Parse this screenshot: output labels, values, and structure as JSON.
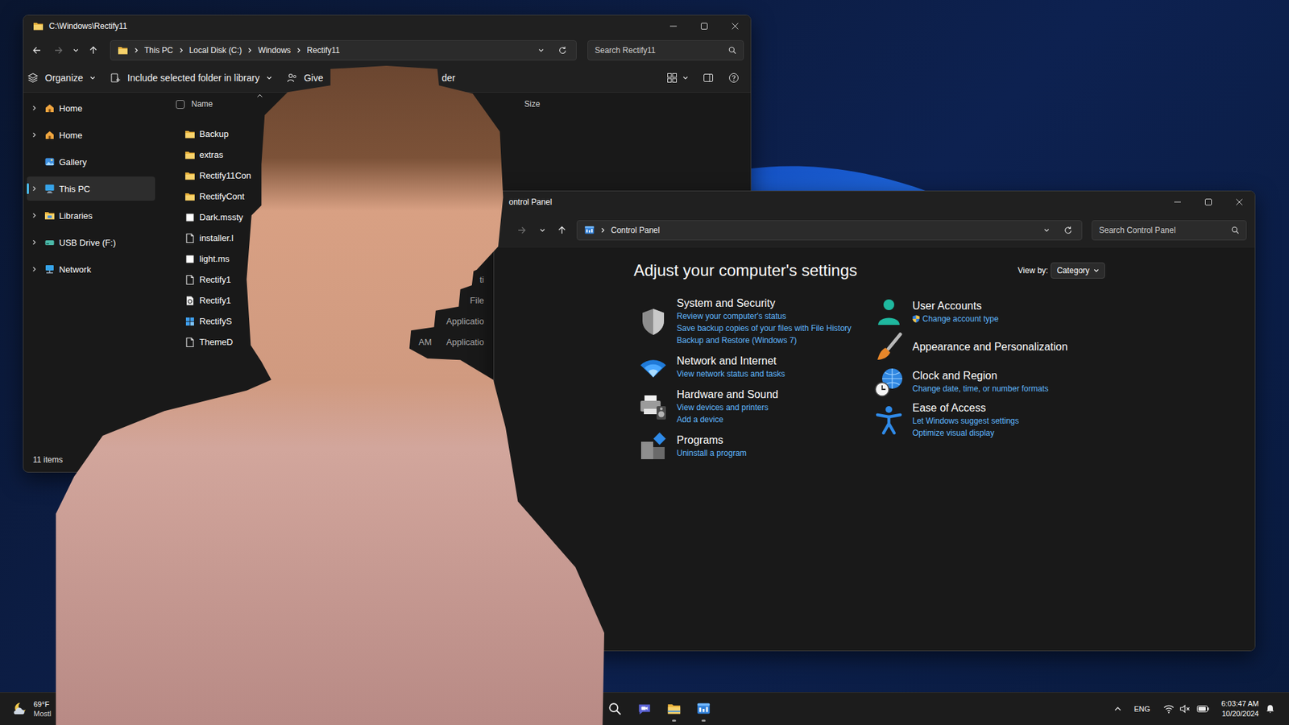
{
  "explorer": {
    "title": "C:\\Windows\\Rectify11",
    "nav": {
      "back_enabled": true,
      "forward_enabled": false
    },
    "breadcrumb": [
      "This PC",
      "Local Disk (C:)",
      "Windows",
      "Rectify11"
    ],
    "search": {
      "placeholder": "Search Rectify11"
    },
    "toolbar": [
      {
        "label": "Organize",
        "dropdown": true
      },
      {
        "label": "Include selected folder in library",
        "dropdown": true
      },
      {
        "label": "Give",
        "dropdown": false
      }
    ],
    "toolbar_fragment": "der",
    "sidebar": [
      {
        "label": "Home",
        "expandable": true,
        "selected": false
      },
      {
        "label": "Home",
        "expandable": true,
        "selected": false
      },
      {
        "label": "Gallery",
        "expandable": false,
        "selected": false
      },
      {
        "label": "This PC",
        "expandable": true,
        "selected": true
      },
      {
        "label": "Libraries",
        "expandable": true,
        "selected": false
      },
      {
        "label": "USB Drive (F:)",
        "expandable": true,
        "selected": false
      },
      {
        "label": "Network",
        "expandable": true,
        "selected": false
      }
    ],
    "columns": {
      "select_all_checked": false,
      "sorted": true,
      "name": "Name",
      "size": "Size"
    },
    "rows": [
      {
        "name": "Backup",
        "kind": "folder"
      },
      {
        "name": "extras",
        "kind": "folder"
      },
      {
        "name": "Rectify11Con",
        "kind": "folder"
      },
      {
        "name": "RectifyCont",
        "kind": "folder"
      },
      {
        "name": "Dark.mssty",
        "kind": "style"
      },
      {
        "name": "installer.l",
        "kind": "file"
      },
      {
        "name": "light.ms",
        "kind": "style"
      },
      {
        "name": "Rectify1",
        "kind": "file",
        "type": "ti"
      },
      {
        "name": "Rectify1",
        "kind": "tool",
        "type": "File"
      },
      {
        "name": "RectifyS",
        "kind": "app",
        "type": "Applicatio"
      },
      {
        "name": "ThemeD",
        "kind": "file",
        "date": "AM",
        "type": "Applicatio"
      }
    ],
    "status": "11 items"
  },
  "control_panel": {
    "title": "ontrol Panel",
    "nav": {
      "forward_enabled": false
    },
    "breadcrumb": [
      "Control Panel"
    ],
    "search": {
      "placeholder": "Search Control Panel"
    },
    "heading": "Adjust your computer's settings",
    "view_by": {
      "label": "View by:",
      "value": "Category"
    },
    "category_columns": [
      [
        {
          "title": "System and Security",
          "links": [
            {
              "label": "Review your computer's status",
              "shield": false
            },
            {
              "label": "Save backup copies of your files with File History",
              "shield": false
            },
            {
              "label": "Backup and Restore (Windows 7)",
              "shield": false
            }
          ]
        },
        {
          "title": "Network and Internet",
          "links": [
            {
              "label": "View network status and tasks",
              "shield": false
            }
          ]
        },
        {
          "title": "Hardware and Sound",
          "links": [
            {
              "label": "View devices and printers",
              "shield": false
            },
            {
              "label": "Add a device",
              "shield": false
            }
          ]
        },
        {
          "title": "Programs",
          "links": [
            {
              "label": "Uninstall a program",
              "shield": false
            }
          ]
        }
      ],
      [
        {
          "title": "User Accounts",
          "links": [
            {
              "label": "Change account type",
              "shield": true
            }
          ]
        },
        {
          "title": "Appearance and Personalization",
          "links": []
        },
        {
          "title": "Clock and Region",
          "links": [
            {
              "label": "Change date, time, or number formats",
              "shield": false
            }
          ]
        },
        {
          "title": "Ease of Access",
          "links": [
            {
              "label": "Let Windows suggest settings",
              "shield": false
            },
            {
              "label": "Optimize visual display",
              "shield": false
            }
          ]
        }
      ]
    ]
  },
  "taskbar": {
    "weather": {
      "temperature": "69°F",
      "condition": "Mostl"
    },
    "apps": [
      {
        "running": false
      },
      {
        "running": false
      },
      {
        "running": true
      },
      {
        "running": true
      }
    ],
    "tray": {
      "language": "ENG",
      "volume_muted": true,
      "time": "6:03:47 AM",
      "date": "10/20/2024"
    }
  }
}
